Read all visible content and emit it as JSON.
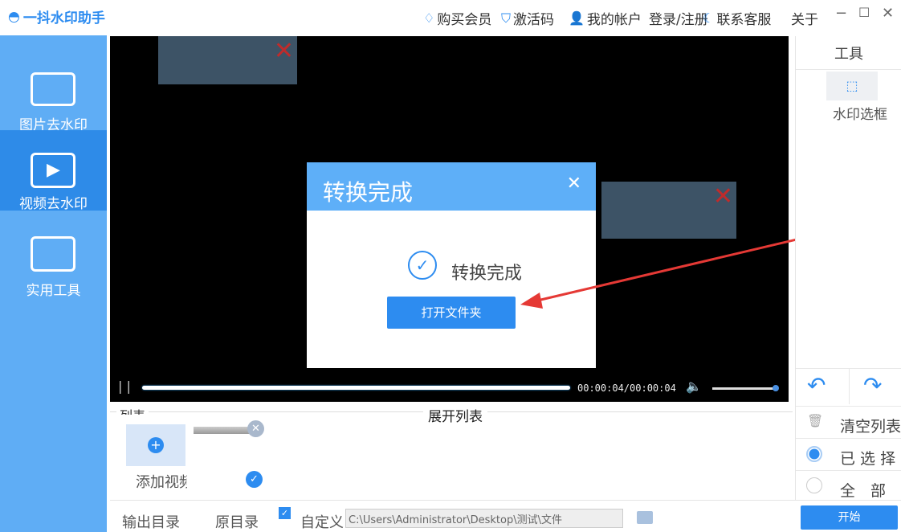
{
  "app": {
    "title": "一抖水印助手"
  },
  "titlebar": {
    "buy": "购买会员",
    "activate": "激活码",
    "account": "我的帐户",
    "login": "登录/注册",
    "contact": "联系客服",
    "about": "关于"
  },
  "sidebar": {
    "items": [
      {
        "label": "图片去水印"
      },
      {
        "label": "视频去水印"
      },
      {
        "label": "实用工具"
      }
    ]
  },
  "player": {
    "time": "00:00:04/00:00:04",
    "progress": 1.0,
    "volume": 1.0
  },
  "dialog": {
    "title": "转换完成",
    "message": "转换完成",
    "button": "打开文件夹"
  },
  "right_panel": {
    "header": "工具",
    "tool": "水印选框",
    "clear": "清空列表",
    "selected": "已 选 择",
    "all": "全　部"
  },
  "list": {
    "title": "列表",
    "expand": "展开列表",
    "add": "添加视频"
  },
  "bottom": {
    "output_label": "输出目录",
    "original": "原目录",
    "custom": "自定义",
    "path": "C:\\Users\\Administrator\\Desktop\\测试\\文件",
    "start": "开始"
  },
  "colors": {
    "accent": "#2d8cf0",
    "sidebar": "#5fadf5",
    "arrow": "#e53935"
  }
}
